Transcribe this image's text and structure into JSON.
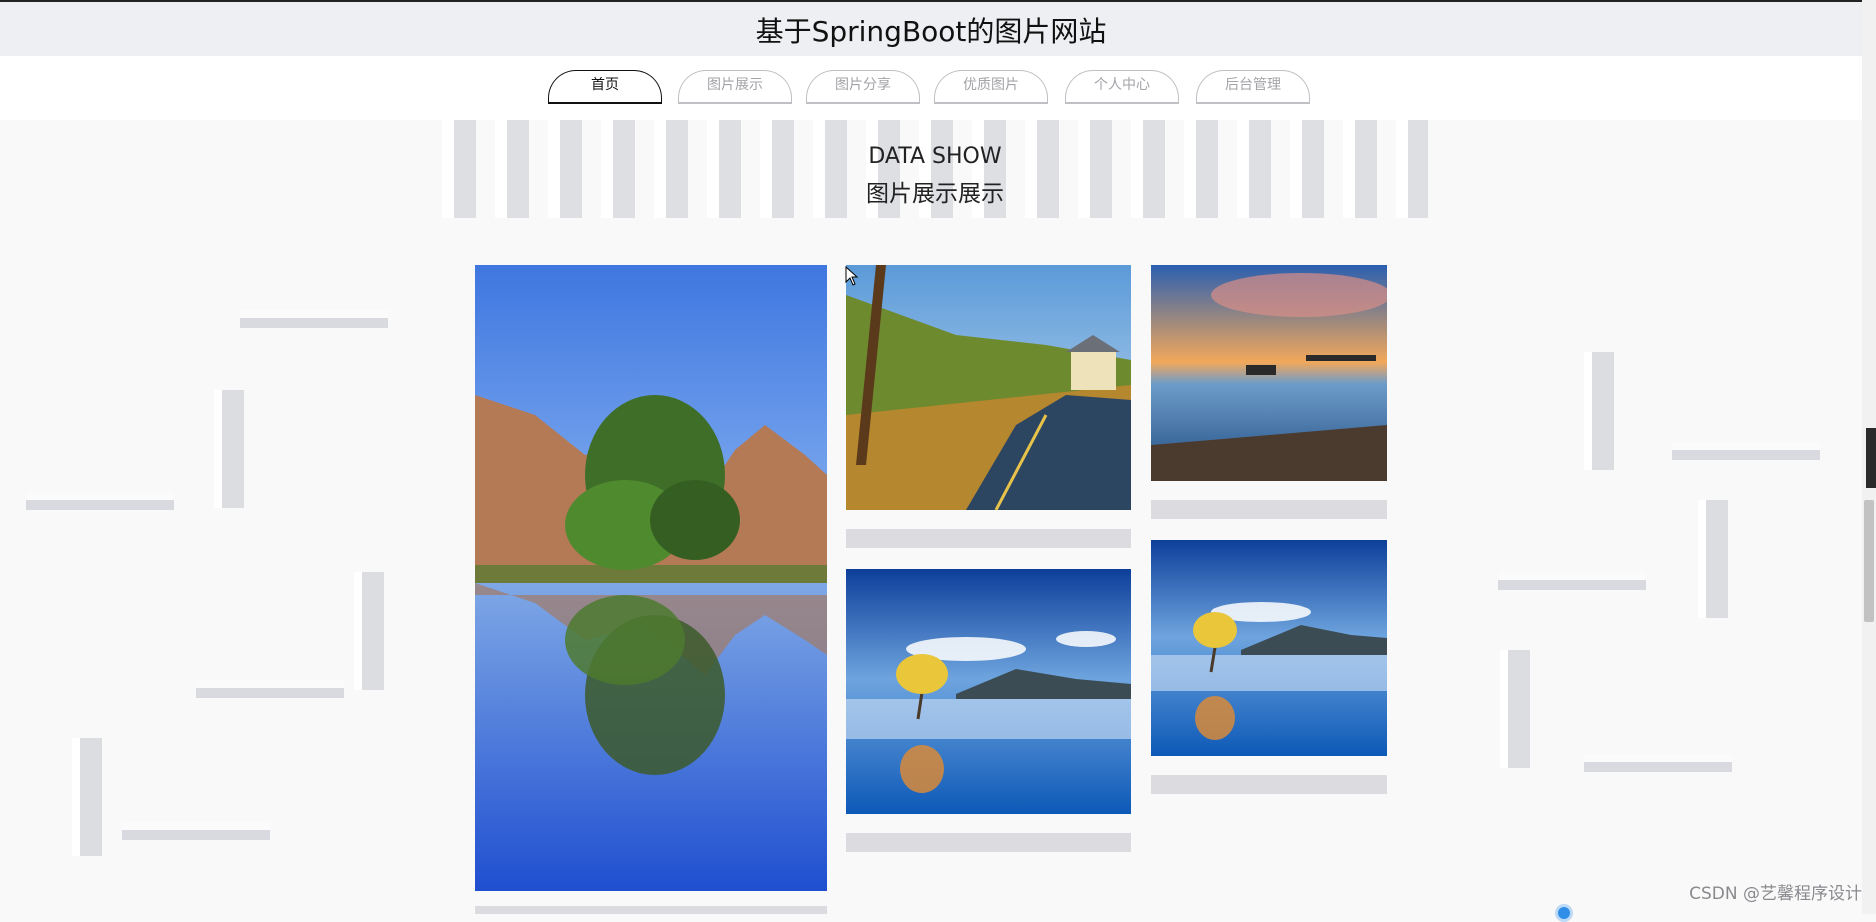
{
  "header": {
    "site_title": "基于SpringBoot的图片网站"
  },
  "nav": {
    "tabs": [
      {
        "label": "首页",
        "active": true
      },
      {
        "label": "图片展示",
        "active": false
      },
      {
        "label": "图片分享",
        "active": false
      },
      {
        "label": "优质图片",
        "active": false
      },
      {
        "label": "个人中心",
        "active": false
      },
      {
        "label": "后台管理",
        "active": false
      }
    ]
  },
  "hero": {
    "subtitle": "DATA SHOW",
    "title": "图片展示展示"
  },
  "gallery": {
    "images": [
      {
        "scene": "lake-island-reflection"
      },
      {
        "scene": "mountain-road-village"
      },
      {
        "scene": "sunset-pier"
      },
      {
        "scene": "lone-tree-in-lake"
      },
      {
        "scene": "lone-tree-in-lake"
      }
    ]
  },
  "watermark": "CSDN @艺馨程序设计",
  "colors": {
    "header_bg": "#eeeff2",
    "page_bg": "#f9f9fa",
    "tab_inactive": "#a3a3a8",
    "caption_bar": "#dcdbe0"
  }
}
